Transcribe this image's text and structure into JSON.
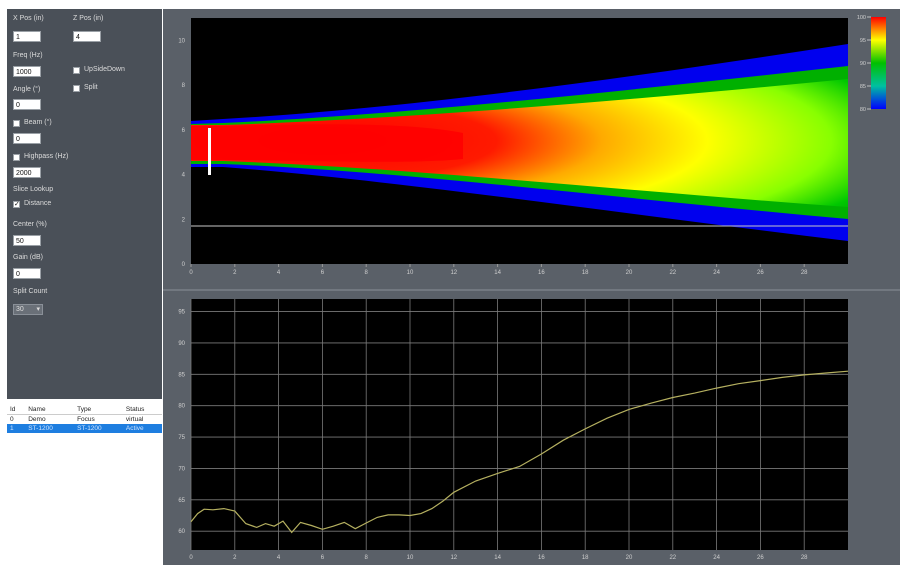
{
  "controls": {
    "x_pos_label": "X Pos (in)",
    "x_pos_value": "1",
    "z_pos_label": "Z Pos (in)",
    "z_pos_value": "4",
    "freq_label": "Freq (Hz)",
    "freq_value": "1000",
    "upsidedown_label": "UpSideDown",
    "split_label": "Split",
    "angle_label": "Angle (°)",
    "angle_value": "0",
    "beam_label": "Beam (°)",
    "beam_value": "0",
    "highpass_label": "Highpass (Hz)",
    "highpass_value": "2000",
    "slice_label": "Slice Lookup",
    "distance_label": "Distance",
    "distance_checked": true,
    "center_label": "Center (%)",
    "center_value": "50",
    "gain_label": "Gain (dB)",
    "gain_value": "0",
    "split_count_label": "Split Count",
    "split_count_value": "30"
  },
  "list": {
    "headers": [
      "Id",
      "Name",
      "Type",
      "Status"
    ],
    "rows": [
      {
        "id": "0",
        "name": "Demo",
        "type": "Focus",
        "status": "virtual",
        "selected": false
      },
      {
        "id": "1",
        "name": "ST-1200",
        "type": "ST-1200",
        "status": "Active",
        "selected": true
      }
    ]
  },
  "heatmap": {
    "y_ticks": [
      "0",
      "2",
      "4",
      "6",
      "8",
      "10"
    ],
    "x_ticks": [
      "0",
      "2",
      "4",
      "6",
      "8",
      "10",
      "12",
      "14",
      "16",
      "18",
      "20",
      "22",
      "24",
      "26",
      "28"
    ],
    "colorbar_ticks": [
      "100",
      "95",
      "90",
      "85",
      "80"
    ],
    "colors": {
      "hot": "#ff0000",
      "mid": "#ffff00",
      "green": "#00c000",
      "cold": "#0000ff",
      "bg": "#000000"
    }
  },
  "chart_data": {
    "type": "line",
    "x_ticks": [
      "0",
      "2",
      "4",
      "6",
      "8",
      "10",
      "12",
      "14",
      "16",
      "18",
      "20",
      "22",
      "24",
      "26",
      "28"
    ],
    "y_ticks": [
      "95",
      "90",
      "85",
      "80",
      "75",
      "70",
      "65",
      "60"
    ],
    "xlim": [
      0,
      30
    ],
    "ylim": [
      57,
      97
    ],
    "grid": true,
    "series": [
      {
        "color": "#b5b060",
        "x": [
          0,
          0.3,
          0.6,
          1,
          1.5,
          2,
          2.5,
          3,
          3.4,
          3.8,
          4.2,
          4.6,
          5,
          5.5,
          6,
          6.5,
          7,
          7.5,
          8,
          8.5,
          9,
          9.5,
          10,
          10.5,
          11,
          11.5,
          12,
          13,
          14,
          15,
          16,
          17,
          18,
          19,
          20,
          21,
          22,
          23,
          24,
          25,
          26,
          27,
          28,
          29,
          30
        ],
        "y": [
          61.5,
          62.8,
          63.5,
          63.4,
          63.6,
          63.2,
          61.2,
          60.6,
          61.2,
          60.8,
          61.6,
          59.8,
          61.4,
          60.9,
          60.3,
          60.8,
          61.4,
          60.4,
          61.3,
          62.2,
          62.6,
          62.6,
          62.5,
          62.8,
          63.6,
          64.8,
          66.2,
          68.0,
          69.2,
          70.3,
          72.3,
          74.5,
          76.3,
          78.0,
          79.4,
          80.4,
          81.3,
          82.0,
          82.8,
          83.5,
          84.0,
          84.5,
          84.9,
          85.2,
          85.5
        ]
      }
    ]
  }
}
